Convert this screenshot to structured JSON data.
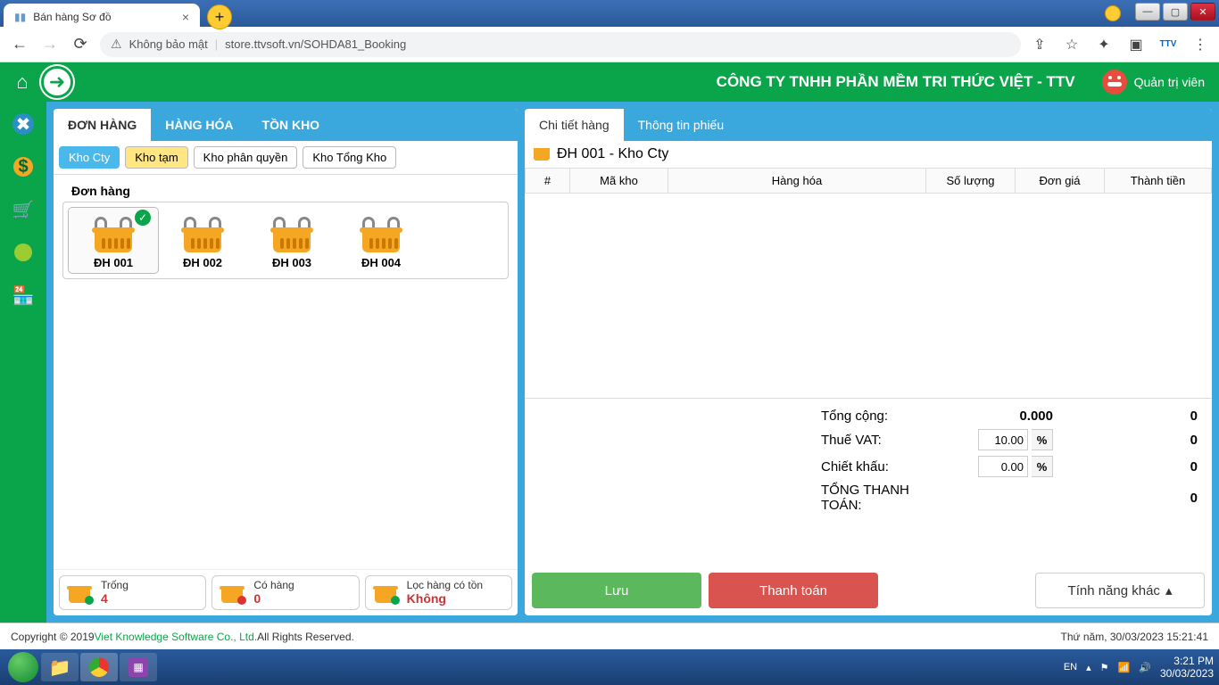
{
  "browser": {
    "tab_title": "Bán hàng Sơ đồ",
    "url_warn": "Không bảo mật",
    "url": "store.ttvsoft.vn/SOHDA81_Booking"
  },
  "header": {
    "company": "CÔNG TY TNHH PHẦN MỀM TRI THỨC VIỆT - TTV",
    "user": "Quản trị viên"
  },
  "left": {
    "tabs": [
      "ĐƠN HÀNG",
      "HÀNG HÓA",
      "TỒN KHO"
    ],
    "sub_tabs": [
      "Kho Cty",
      "Kho tạm",
      "Kho phân quyền",
      "Kho Tổng Kho"
    ],
    "section_title": "Đơn hàng",
    "orders": [
      "ĐH 001",
      "ĐH 002",
      "ĐH 003",
      "ĐH 004"
    ],
    "stats": {
      "empty_label": "Trống",
      "empty_val": "4",
      "has_label": "Có hàng",
      "has_val": "0",
      "filter_label": "Lọc hàng có tồn",
      "filter_val": "Không"
    }
  },
  "right": {
    "tabs": [
      "Chi tiết hàng",
      "Thông tin phiếu"
    ],
    "title": "ĐH 001 - Kho Cty",
    "cols": [
      "#",
      "Mã kho",
      "Hàng hóa",
      "Số lượng",
      "Đơn giá",
      "Thành tiền"
    ],
    "totals": {
      "sum_label": "Tổng cộng:",
      "sum_mid": "0.000",
      "sum_val": "0",
      "vat_label": "Thuế VAT:",
      "vat_input": "10.00",
      "vat_val": "0",
      "disc_label": "Chiết khấu:",
      "disc_input": "0.00",
      "disc_val": "0",
      "grand_label": "TỔNG THANH TOÁN:",
      "grand_val": "0"
    },
    "btn_save": "Lưu",
    "btn_pay": "Thanh toán",
    "btn_more": "Tính năng khác"
  },
  "footer": {
    "copyright": "Copyright © 2019 ",
    "company": "Viet Knowledge Software Co., Ltd.",
    "rights": " All Rights Reserved.",
    "datetime": "Thứ năm, 30/03/2023 15:21:41"
  },
  "taskbar": {
    "lang": "EN",
    "time": "3:21 PM",
    "date": "30/03/2023"
  }
}
